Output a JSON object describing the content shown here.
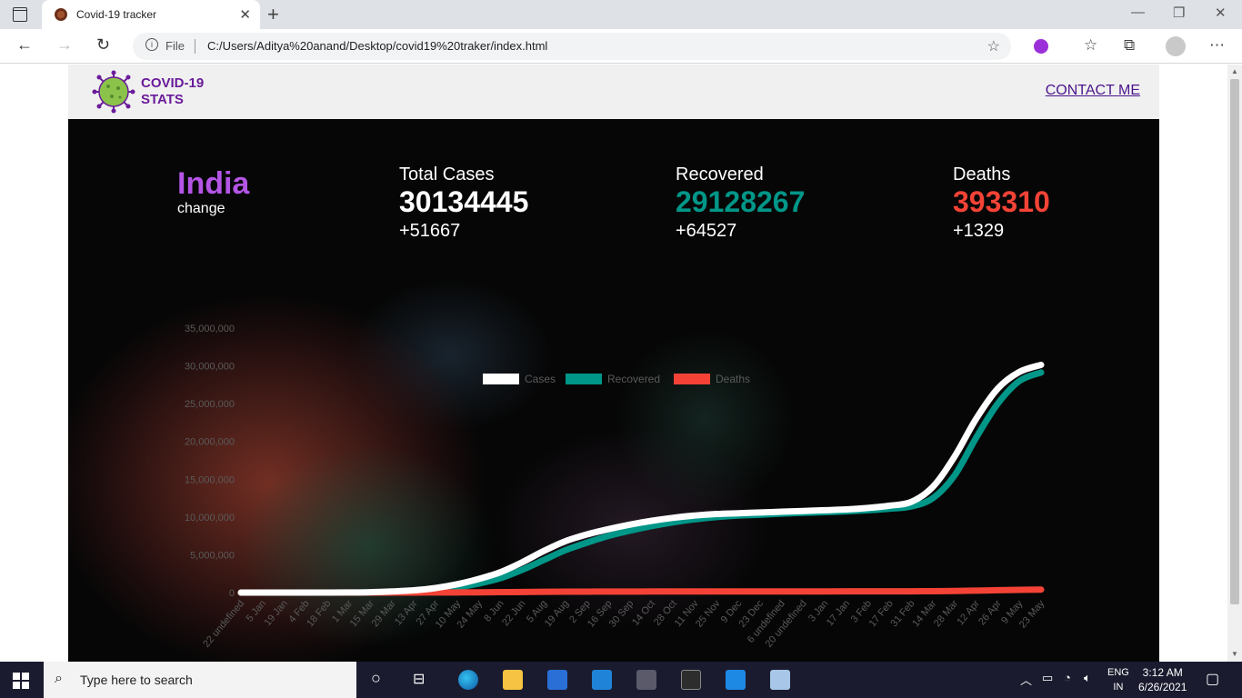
{
  "browser": {
    "tab_title": "Covid-19 tracker",
    "url_scheme": "File",
    "url": "C:/Users/Aditya%20anand/Desktop/covid19%20traker/index.html"
  },
  "site": {
    "logo_line1": "COVID-19",
    "logo_line2": "STATS",
    "contact_label": "CONTACT ME"
  },
  "summary": {
    "country": "India",
    "change_label": "change",
    "total": {
      "label": "Total Cases",
      "value": "30134445",
      "delta": "+51667",
      "color": "#ffffff"
    },
    "recovered": {
      "label": "Recovered",
      "value": "29128267",
      "delta": "+64527",
      "color": "#009688"
    },
    "deaths": {
      "label": "Deaths",
      "value": "393310",
      "delta": "+1329",
      "color": "#f44336"
    }
  },
  "chart_data": {
    "type": "line",
    "x": [
      "22 undefined",
      "5 Jan",
      "19 Jan",
      "4 Feb",
      "18 Feb",
      "1 Mar",
      "15 Mar",
      "29 Mar",
      "13 Apr",
      "27 Apr",
      "10 May",
      "24 May",
      "8 Jun",
      "22 Jun",
      "5 Aug",
      "19 Aug",
      "2 Sep",
      "16 Sep",
      "30 Sep",
      "14 Oct",
      "28 Oct",
      "11 Nov",
      "25 Nov",
      "9 Dec",
      "23 Dec",
      "6 undefined",
      "20 undefined",
      "3 Jan",
      "17 Jan",
      "3 Feb",
      "17 Feb",
      "31 Feb",
      "14 Mar",
      "28 Mar",
      "12 Apr",
      "26 Apr",
      "9 May",
      "23 May"
    ],
    "series": [
      {
        "name": "Cases",
        "color": "#ffffff",
        "values": [
          0,
          0,
          0,
          0,
          0,
          10000,
          50000,
          150000,
          300000,
          600000,
          1100000,
          1800000,
          2700000,
          4000000,
          5500000,
          6800000,
          7700000,
          8400000,
          9000000,
          9500000,
          9900000,
          10200000,
          10400000,
          10500000,
          10600000,
          10700000,
          10800000,
          10900000,
          11000000,
          11200000,
          11500000,
          12000000,
          14000000,
          18000000,
          23000000,
          27000000,
          29200000,
          30134445
        ]
      },
      {
        "name": "Recovered",
        "color": "#009688",
        "values": [
          0,
          0,
          0,
          0,
          0,
          5000,
          20000,
          70000,
          150000,
          350000,
          700000,
          1200000,
          1900000,
          3000000,
          4300000,
          5600000,
          6600000,
          7500000,
          8200000,
          8800000,
          9300000,
          9700000,
          10000000,
          10200000,
          10300000,
          10450000,
          10550000,
          10650000,
          10750000,
          10900000,
          11100000,
          11400000,
          12500000,
          15500000,
          20500000,
          25000000,
          28000000,
          29128267
        ]
      },
      {
        "name": "Deaths",
        "color": "#f44336",
        "values": [
          0,
          0,
          0,
          0,
          0,
          100,
          500,
          2000,
          5000,
          10000,
          20000,
          35000,
          55000,
          80000,
          100000,
          115000,
          125000,
          133000,
          140000,
          145000,
          148000,
          150000,
          152000,
          153000,
          154000,
          155000,
          156000,
          157000,
          158000,
          160000,
          163000,
          170000,
          185000,
          215000,
          260000,
          310000,
          360000,
          393310
        ]
      }
    ],
    "yticks": [
      "0",
      "5,000,000",
      "10,000,000",
      "15,000,000",
      "20,000,000",
      "25,000,000",
      "30,000,000",
      "35,000,000"
    ],
    "ylim": [
      0,
      35000000
    ],
    "legend_position": "top-center",
    "grid": false
  },
  "taskbar": {
    "search_placeholder": "Type here to search",
    "lang_line1": "ENG",
    "lang_line2": "IN",
    "time": "3:12 AM",
    "date": "6/26/2021"
  }
}
